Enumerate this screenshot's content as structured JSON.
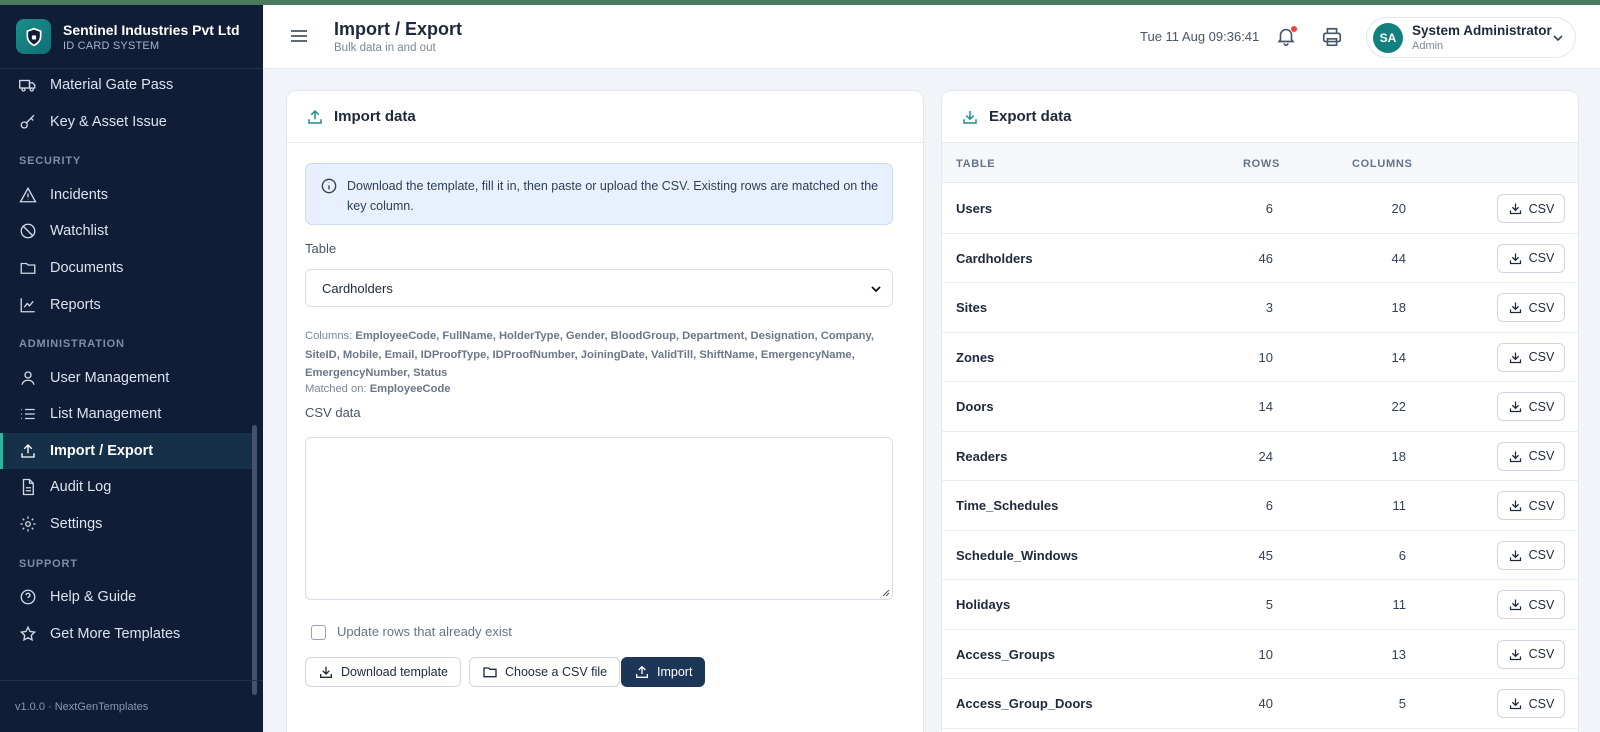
{
  "brand": {
    "name": "Sentinel Industries Pvt Ltd",
    "subtitle": "ID CARD SYSTEM"
  },
  "sidebar": {
    "items": [
      {
        "label": "Material Gate Pass",
        "icon": "truck-icon"
      },
      {
        "label": "Key & Asset Issue",
        "icon": "key-icon"
      },
      {
        "label": "Incidents",
        "icon": "warning-icon"
      },
      {
        "label": "Watchlist",
        "icon": "ban-icon"
      },
      {
        "label": "Documents",
        "icon": "folder-icon"
      },
      {
        "label": "Reports",
        "icon": "chart-icon"
      },
      {
        "label": "User Management",
        "icon": "user-icon"
      },
      {
        "label": "List Management",
        "icon": "list-icon"
      },
      {
        "label": "Import / Export",
        "icon": "upload-icon",
        "active": true
      },
      {
        "label": "Audit Log",
        "icon": "document-icon"
      },
      {
        "label": "Settings",
        "icon": "gear-icon"
      },
      {
        "label": "Help & Guide",
        "icon": "help-icon"
      },
      {
        "label": "Get More Templates",
        "icon": "star-icon"
      }
    ],
    "sections": [
      "SECURITY",
      "ADMINISTRATION",
      "SUPPORT"
    ],
    "footer": "v1.0.0 · NextGenTemplates"
  },
  "header": {
    "title": "Import / Export",
    "subtitle": "Bulk data in and out",
    "datetime": "Tue 11 Aug 09:36:41",
    "user": {
      "initials": "SA",
      "name": "System Administrator",
      "role": "Admin"
    }
  },
  "import": {
    "title": "Import data",
    "info": "Download the template, fill it in, then paste or upload the CSV. Existing rows are matched on the key column.",
    "table_label": "Table",
    "table_value": "Cardholders",
    "columns_prefix": "Columns:",
    "columns": "EmployeeCode, FullName, HolderType, Gender, BloodGroup, Department, Designation, Company, SiteID, Mobile, Email, IDProofType, IDProofNumber, JoiningDate, ValidTill, ShiftName, EmergencyName, EmergencyNumber, Status",
    "matched_prefix": "Matched on:",
    "matched_key": "EmployeeCode",
    "csv_label": "CSV data",
    "csv_value": "",
    "update_label": "Update rows that already exist",
    "update_checked": false,
    "buttons": {
      "download": "Download template",
      "choose": "Choose a CSV file",
      "import": "Import"
    }
  },
  "export": {
    "title": "Export data",
    "headers": {
      "table": "TABLE",
      "rows": "ROWS",
      "columns": "COLUMNS"
    },
    "button_label": "CSV",
    "rows": [
      {
        "name": "Users",
        "rows": "6",
        "columns": "20"
      },
      {
        "name": "Cardholders",
        "rows": "46",
        "columns": "44"
      },
      {
        "name": "Sites",
        "rows": "3",
        "columns": "18"
      },
      {
        "name": "Zones",
        "rows": "10",
        "columns": "14"
      },
      {
        "name": "Doors",
        "rows": "14",
        "columns": "22"
      },
      {
        "name": "Readers",
        "rows": "24",
        "columns": "18"
      },
      {
        "name": "Time_Schedules",
        "rows": "6",
        "columns": "11"
      },
      {
        "name": "Schedule_Windows",
        "rows": "45",
        "columns": "6"
      },
      {
        "name": "Holidays",
        "rows": "5",
        "columns": "11"
      },
      {
        "name": "Access_Groups",
        "rows": "10",
        "columns": "13"
      },
      {
        "name": "Access_Group_Doors",
        "rows": "40",
        "columns": "5"
      }
    ]
  }
}
